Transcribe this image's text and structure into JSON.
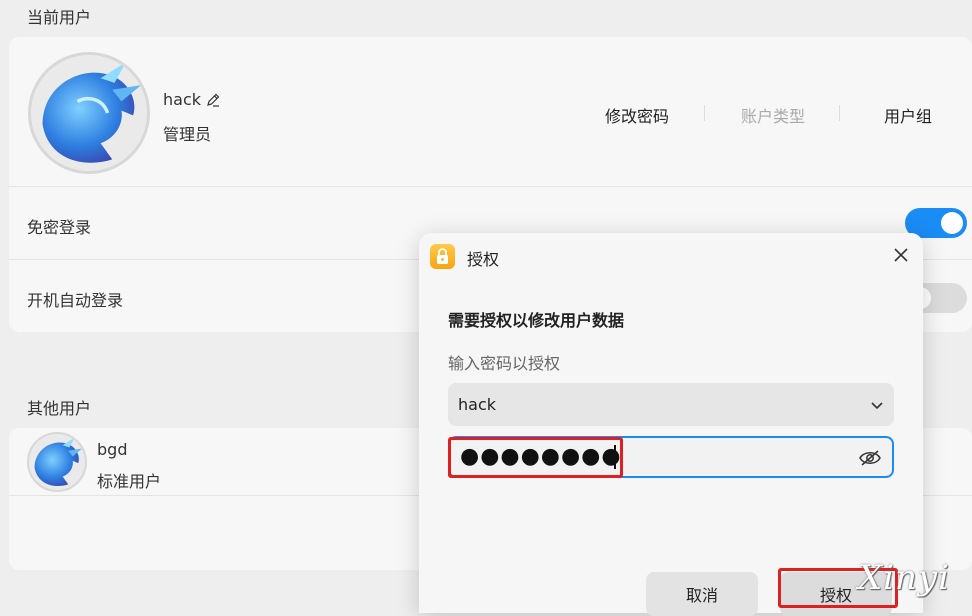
{
  "current_user": {
    "section_title": "当前用户",
    "name": "hack",
    "role": "管理员",
    "actions": [
      {
        "label": "修改密码",
        "enabled": true
      },
      {
        "label": "账户类型",
        "enabled": false
      },
      {
        "label": "用户组",
        "enabled": true
      }
    ],
    "settings": [
      {
        "label": "免密登录",
        "on": true
      },
      {
        "label": "开机自动登录",
        "on": false
      }
    ]
  },
  "other_users": {
    "section_title": "其他用户",
    "users": [
      {
        "name": "bgd",
        "role": "标准用户"
      }
    ]
  },
  "dialog": {
    "title": "授权",
    "heading": "需要授权以修改用户数据",
    "subtitle": "输入密码以授权",
    "selected_user": "hack",
    "password_mask": "●●●●●●●●",
    "cancel_label": "取消",
    "confirm_label": "授权"
  },
  "watermark": "Xinyi",
  "colors": {
    "accent": "#1a8cf5",
    "highlight": "#e02020"
  }
}
